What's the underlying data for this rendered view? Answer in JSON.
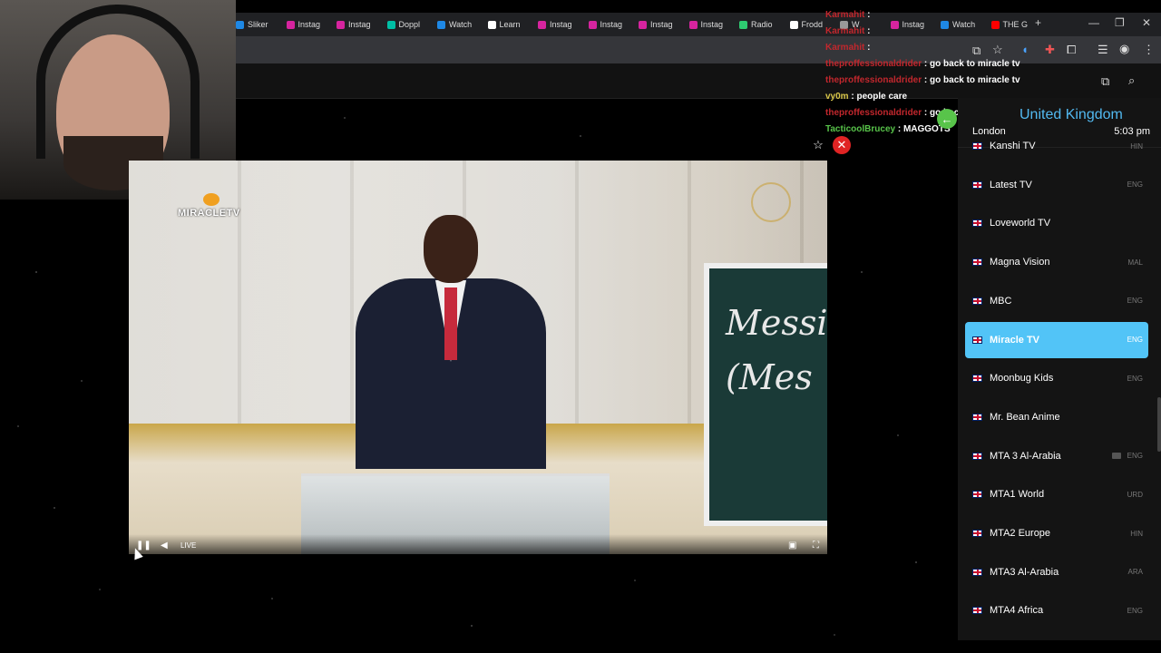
{
  "browser": {
    "tabs": [
      {
        "label": "Sliker",
        "color": "#1e88e5"
      },
      {
        "label": "Instag",
        "color": "#d6249f"
      },
      {
        "label": "Instag",
        "color": "#d6249f"
      },
      {
        "label": "Doppl",
        "color": "#00bfa5"
      },
      {
        "label": "Watch",
        "color": "#1e88e5"
      },
      {
        "label": "Learn",
        "color": "#ffffff"
      },
      {
        "label": "Instag",
        "color": "#d6249f"
      },
      {
        "label": "Instag",
        "color": "#d6249f"
      },
      {
        "label": "Instag",
        "color": "#d6249f"
      },
      {
        "label": "Instag",
        "color": "#d6249f"
      },
      {
        "label": "Radio",
        "color": "#2ecc71"
      },
      {
        "label": "Frodd",
        "color": "#ffffff"
      },
      {
        "label": "W",
        "color": "#999999"
      },
      {
        "label": "Instag",
        "color": "#d6249f"
      },
      {
        "label": "Watch",
        "color": "#1e88e5"
      },
      {
        "label": "THE G",
        "color": "#ff0000"
      }
    ],
    "new_tab": "+",
    "minimize": "—",
    "restore": "❐",
    "close": "✕"
  },
  "player": {
    "logo": "MIRACLETV",
    "live_label": "LIVE",
    "board_text_1": "Messi",
    "board_text_2": "(Mes"
  },
  "chat": [
    {
      "user": "Karmahit",
      "text": ":",
      "color": "red"
    },
    {
      "user": "Karmahit",
      "text": ":",
      "color": "red"
    },
    {
      "user": "Karmahit",
      "text": ":",
      "color": "red"
    },
    {
      "user": "theproffessionaldrider",
      "text": ": go back to miracle tv",
      "color": "red"
    },
    {
      "user": "theproffessionaldrider",
      "text": ": go back to miracle tv",
      "color": "red"
    },
    {
      "user": "vy0m",
      "text": ": people care",
      "color": "yellow"
    },
    {
      "user": "theproffessionaldrider",
      "text": ": go back to miracle tv",
      "color": "red"
    },
    {
      "user": "TacticoolBrucey",
      "text": ": MAGGOTS",
      "color": "green"
    }
  ],
  "sidebar": {
    "country": "United Kingdom",
    "city": "London",
    "time": "5:03 pm",
    "channels": [
      {
        "name": "Kanshi TV",
        "lang": "HIN"
      },
      {
        "name": "Latest TV",
        "lang": "ENG"
      },
      {
        "name": "Loveworld TV",
        "lang": ""
      },
      {
        "name": "Magna Vision",
        "lang": "MAL"
      },
      {
        "name": "MBC",
        "lang": "ENG"
      },
      {
        "name": "Miracle TV",
        "lang": "ENG",
        "active": true
      },
      {
        "name": "Moonbug Kids",
        "lang": "ENG"
      },
      {
        "name": "Mr. Bean Anime",
        "lang": ""
      },
      {
        "name": "MTA 3 Al-Arabia",
        "lang": "ENG",
        "cc": true
      },
      {
        "name": "MTA1 World",
        "lang": "URD"
      },
      {
        "name": "MTA2 Europe",
        "lang": "HIN"
      },
      {
        "name": "MTA3 Al-Arabia",
        "lang": "ARA"
      },
      {
        "name": "MTA4 Africa",
        "lang": "ENG"
      }
    ]
  }
}
